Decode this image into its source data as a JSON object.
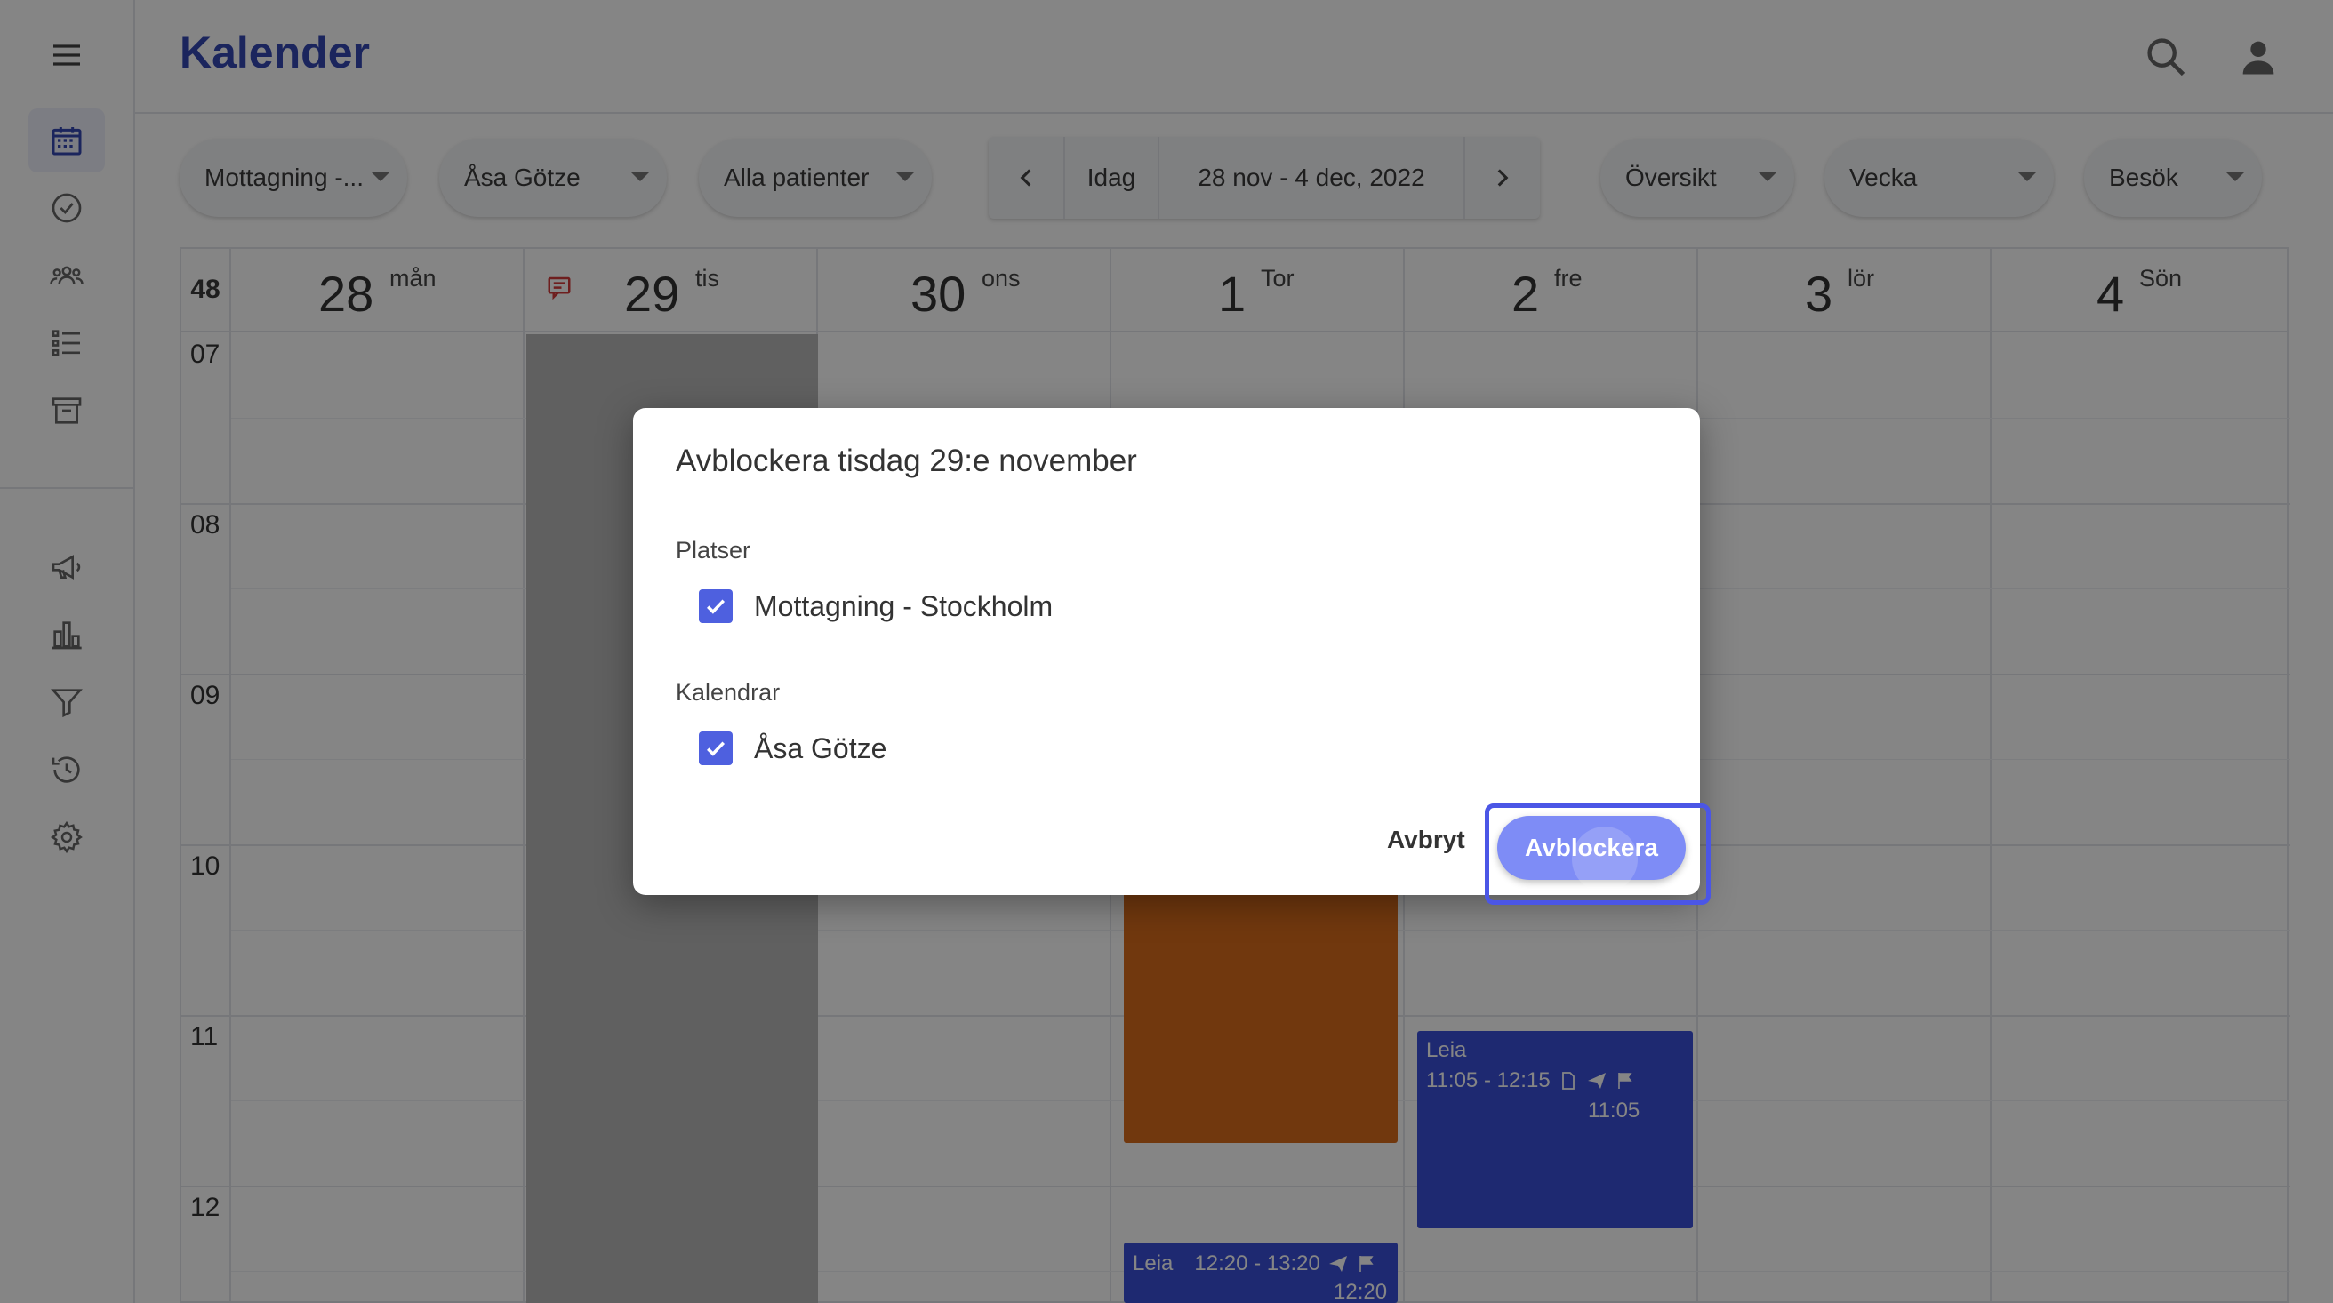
{
  "app": {
    "title": "Kalender"
  },
  "toolbar": {
    "location": "Mottagning -...",
    "calendar": "Åsa Götze",
    "patients": "Alla patienter",
    "today": "Idag",
    "range": "28 nov - 4 dec, 2022",
    "view_overview": "Översikt",
    "view_period": "Vecka",
    "view_type": "Besök"
  },
  "calendar": {
    "week_number": "48",
    "days": [
      {
        "num": "28",
        "wd": "mån"
      },
      {
        "num": "29",
        "wd": "tis"
      },
      {
        "num": "30",
        "wd": "ons"
      },
      {
        "num": "1",
        "wd": "Tor"
      },
      {
        "num": "2",
        "wd": "fre"
      },
      {
        "num": "3",
        "wd": "lör"
      },
      {
        "num": "4",
        "wd": "Sön"
      }
    ],
    "hours": [
      "07",
      "08",
      "09",
      "10",
      "11",
      "12"
    ],
    "events": [
      {
        "title": "Leia",
        "time": "11:05 - 12:15",
        "start": "11:05"
      },
      {
        "title": "Leia",
        "time": "12:20 - 13:20",
        "start": "12:20"
      }
    ]
  },
  "dialog": {
    "title": "Avblockera tisdag 29:e november",
    "places_label": "Platser",
    "place_item": "Mottagning - Stockholm",
    "calendars_label": "Kalendrar",
    "calendar_item": "Åsa Götze",
    "cancel": "Avbryt",
    "confirm": "Avblockera"
  },
  "colors": {
    "brand": "#3447b3",
    "accent": "#4e60df",
    "event_blue": "#3a4fd8",
    "event_orange": "#d86b1c",
    "blocked_gray": "#b8b8b8"
  }
}
